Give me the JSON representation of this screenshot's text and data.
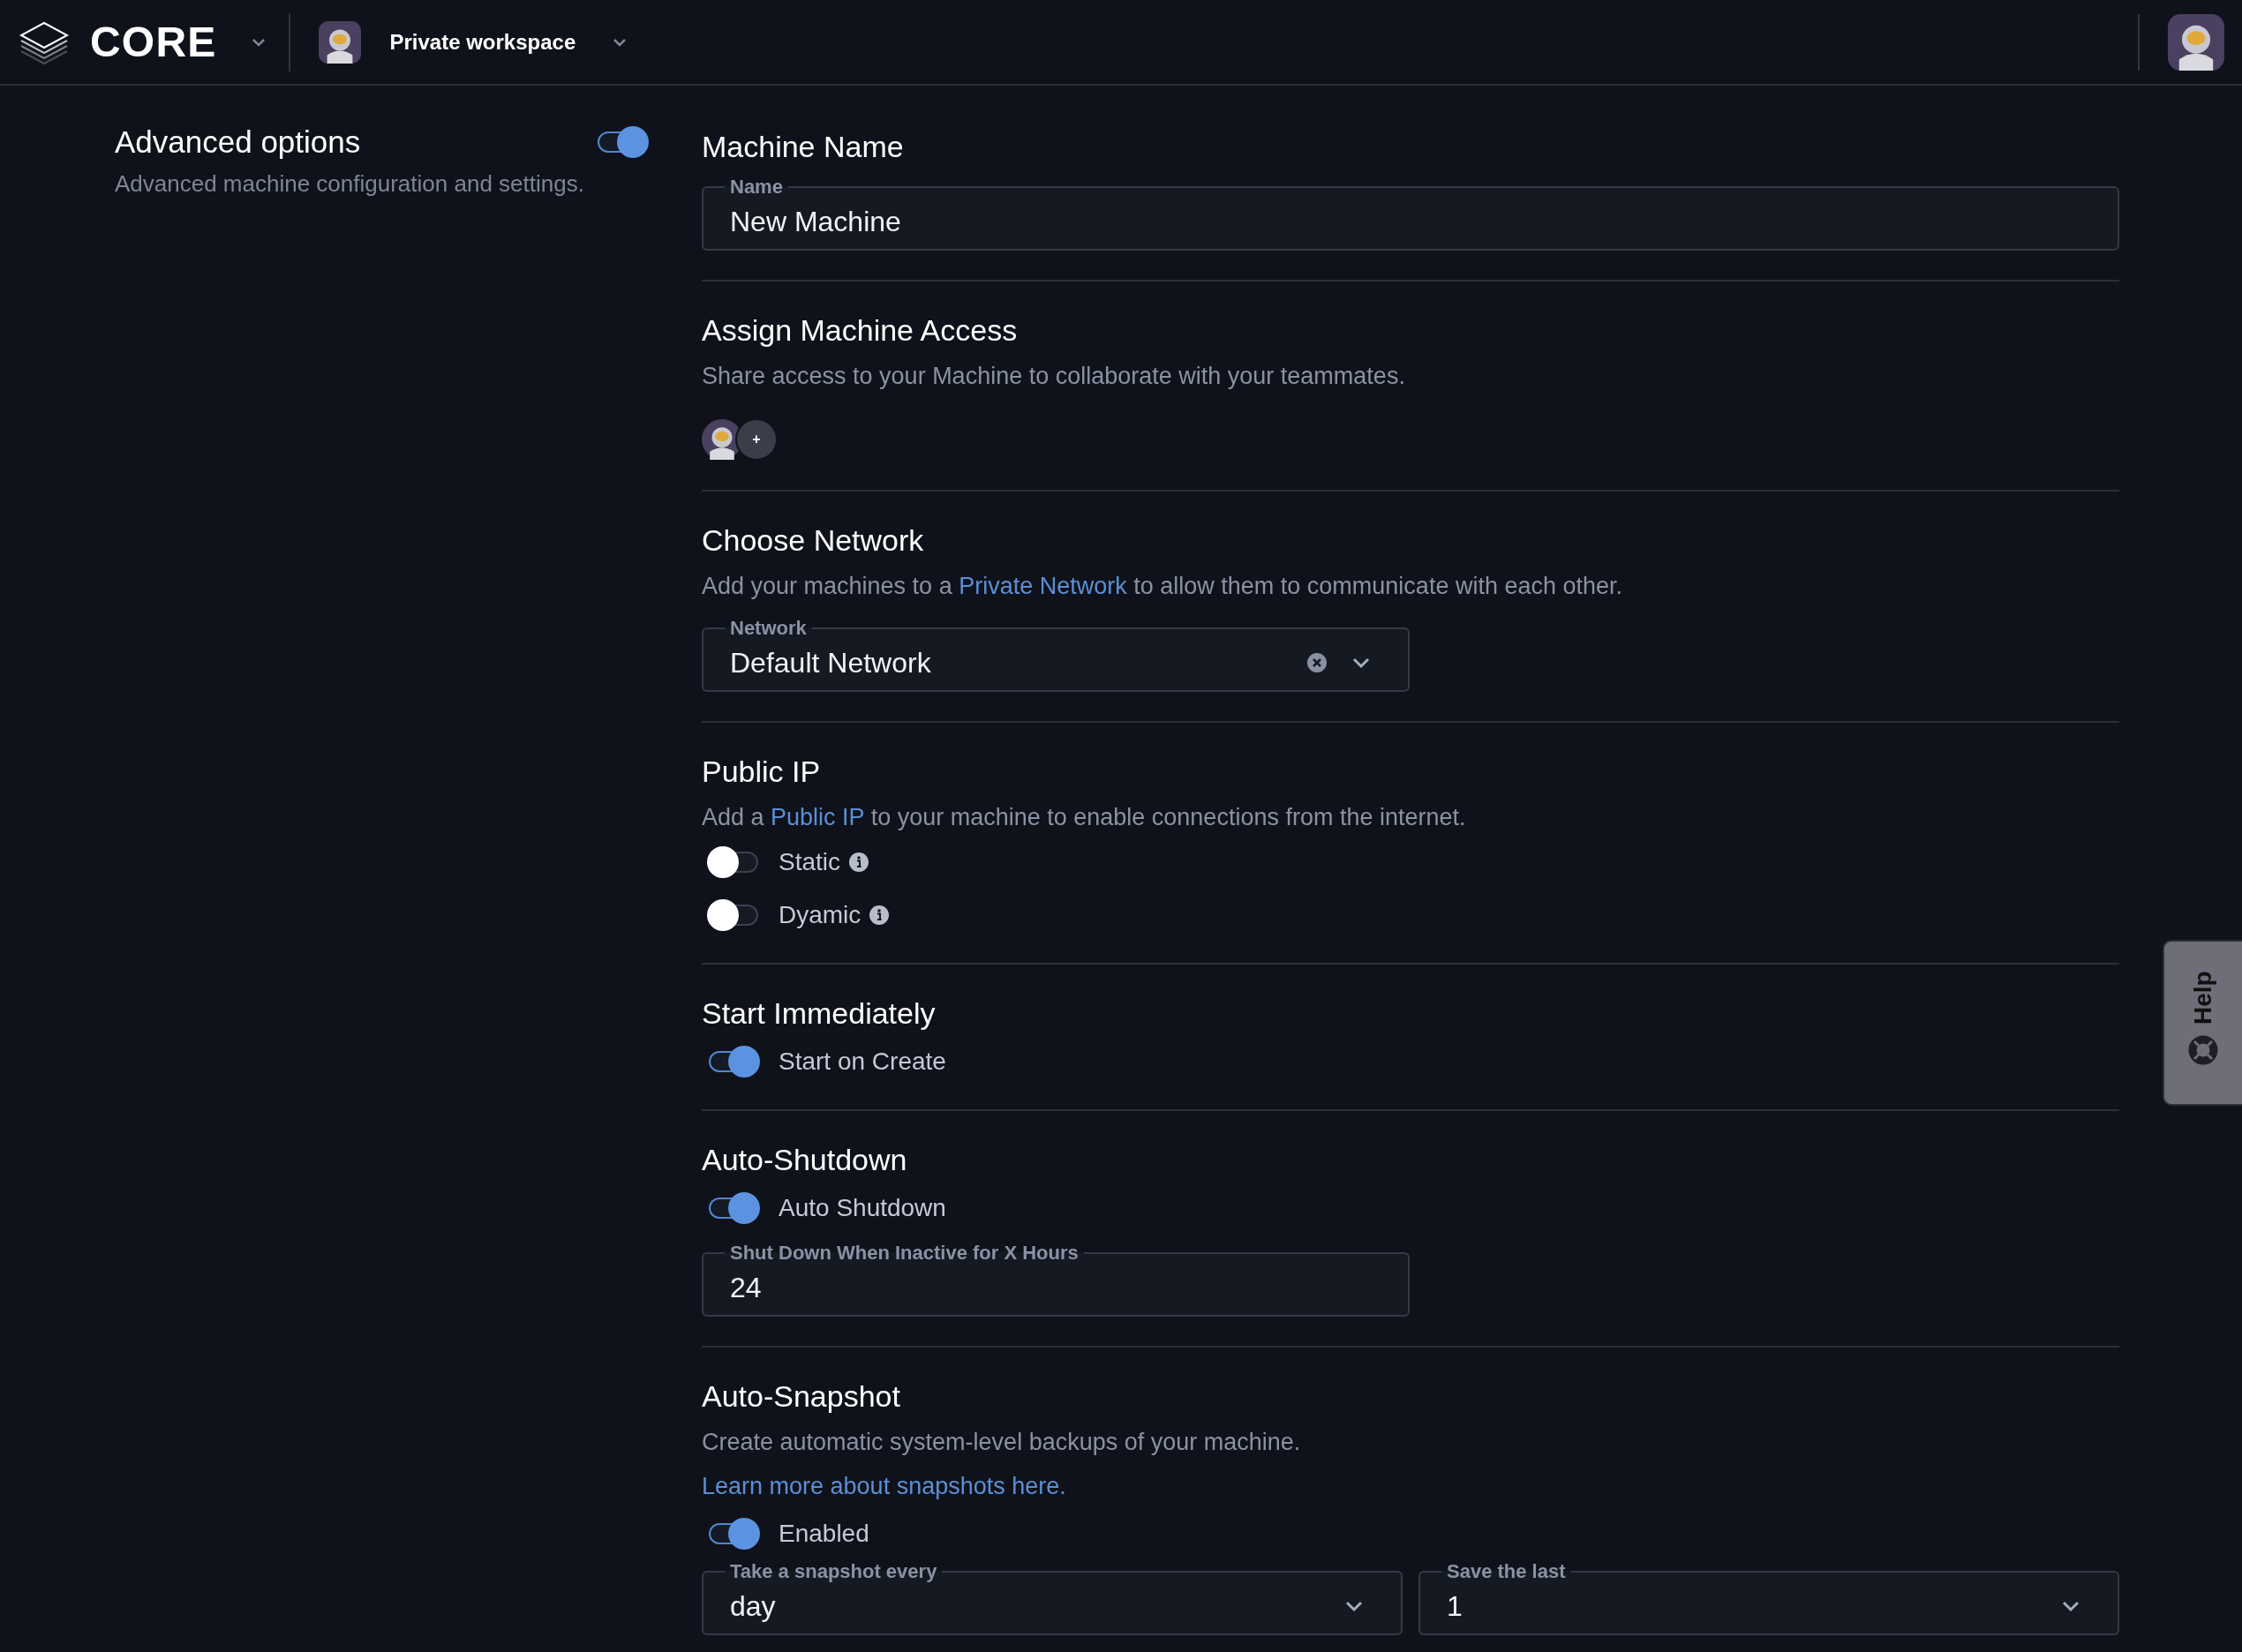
{
  "header": {
    "brand": "CORE",
    "workspace": "Private workspace"
  },
  "advanced": {
    "title": "Advanced options",
    "description": "Advanced machine configuration and settings.",
    "on": true
  },
  "sections": [
    {
      "kind": "name",
      "title": "Machine Name",
      "fields": [
        {
          "label": "Name",
          "value": "New Machine",
          "dropdown": false,
          "clearable": false
        }
      ]
    },
    {
      "kind": "access",
      "title": "Assign Machine Access",
      "description": {
        "text": "Share access to your Machine to collaborate with your teammates."
      },
      "add_button": "+"
    },
    {
      "kind": "network",
      "title": "Choose Network",
      "description": {
        "before": "Add your machines to a ",
        "link": "Private Network",
        "after": " to allow them to communicate with each other."
      },
      "fields": [
        {
          "label": "Network",
          "value": "Default Network",
          "dropdown": true,
          "clearable": true
        }
      ]
    },
    {
      "kind": "ip",
      "title": "Public IP",
      "description": {
        "before": "Add a ",
        "link": "Public IP",
        "after": " to your machine to enable connections from the internet."
      },
      "toggles": [
        {
          "label": "Static",
          "on": false,
          "info": true
        },
        {
          "label": "Dyamic",
          "on": false,
          "info": true
        }
      ]
    },
    {
      "kind": "start",
      "title": "Start Immediately",
      "toggles": [
        {
          "label": "Start on Create",
          "on": true,
          "info": false
        }
      ]
    },
    {
      "kind": "shutdown",
      "title": "Auto-Shutdown",
      "toggles": [
        {
          "label": "Auto Shutdown",
          "on": true,
          "info": false
        }
      ],
      "fields": [
        {
          "label": "Shut Down When Inactive for X Hours",
          "value": "24",
          "dropdown": false,
          "clearable": false
        }
      ]
    },
    {
      "kind": "snapshot",
      "title": "Auto-Snapshot",
      "description": {
        "text": "Create automatic system-level backups of your machine."
      },
      "link_line": "Learn more about snapshots here.",
      "toggles": [
        {
          "label": "Enabled",
          "on": true,
          "info": false
        }
      ],
      "fields": [
        {
          "label": "Take a snapshot every",
          "value": "day",
          "dropdown": true,
          "clearable": false
        },
        {
          "label": "Save the last",
          "value": "1",
          "dropdown": true,
          "clearable": false
        }
      ]
    }
  ],
  "help": {
    "label": "Help"
  }
}
